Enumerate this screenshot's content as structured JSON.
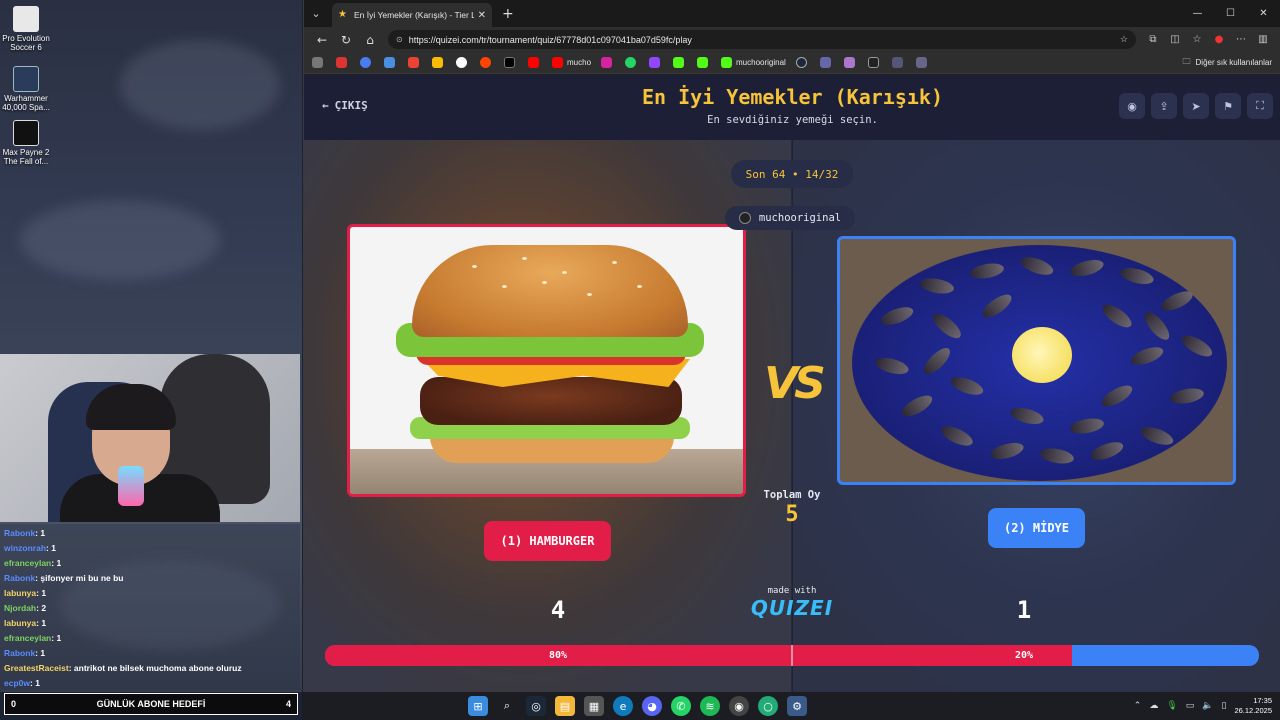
{
  "desktop": {
    "icons": [
      {
        "label": "Pro Evolution Soccer 6",
        "name": "pes6-icon"
      },
      {
        "label": "Warhammer 40,000 Spa...",
        "name": "warhammer-icon"
      },
      {
        "label": "Max Payne 2 The Fall of...",
        "name": "maxpayne-icon"
      }
    ]
  },
  "chat": {
    "lines": [
      {
        "user": "Rabonk",
        "color": "#5b8cff",
        "msg": ": 1"
      },
      {
        "user": "winzonrah",
        "color": "#5b8cff",
        "msg": ": 1"
      },
      {
        "user": "efranceylan",
        "color": "#7dd35f",
        "msg": ": 1"
      },
      {
        "user": "Rabonk",
        "color": "#5b8cff",
        "msg": ": şifonyer mi bu ne bu"
      },
      {
        "user": "labunya",
        "color": "#f6d365",
        "msg": ": 1"
      },
      {
        "user": "Njordah",
        "color": "#7dd35f",
        "msg": ": 2"
      },
      {
        "user": "labunya",
        "color": "#f6d365",
        "msg": ": 1"
      },
      {
        "user": "efranceylan",
        "color": "#7dd35f",
        "msg": ": 1"
      },
      {
        "user": "Rabonk",
        "color": "#5b8cff",
        "msg": ": 1"
      },
      {
        "user": "GreatestRaceist",
        "color": "#f6d365",
        "msg": ": antrikot ne bilsek muchoma abone oluruz"
      },
      {
        "user": "ecp0w",
        "color": "#5b8cff",
        "msg": ": 1"
      }
    ]
  },
  "goal": {
    "left": "0",
    "label": "GÜNLÜK ABONE HEDEFİ",
    "right": "4"
  },
  "browser": {
    "tab_title": "En İyi Yemekler (Karışık) - Tier List...",
    "url": "https://quizei.com/tr/tournament/quiz/67778d01c097041ba07d59fc/play",
    "bookmarks": [
      "mucho",
      "muchooriginal"
    ],
    "other_bookmarks": "Diğer sık kullanılanlar"
  },
  "page": {
    "exit_label": "ÇIKIŞ",
    "title": "En İyi Yemekler (Karışık)",
    "subtitle": "En sevdiğiniz yemeği seçin.",
    "round": "Son 64 • 14/32",
    "creator": "muchooriginal",
    "vs": "VS",
    "total_label": "Toplam Oy",
    "total_value": "5",
    "left": {
      "choice": "(1) HAMBURGER",
      "votes": "4",
      "pct_text": "80%",
      "pct": 0.8
    },
    "right": {
      "choice": "(2) MİDYE",
      "votes": "1",
      "pct_text": "20%"
    },
    "made_with": "made with",
    "brand": "QUIZEI"
  },
  "taskbar": {
    "time": "17:35",
    "date": "26.12.2025"
  },
  "colors": {
    "accent": "#f6c33b",
    "left": "#e11d48",
    "right": "#3b82f6"
  }
}
